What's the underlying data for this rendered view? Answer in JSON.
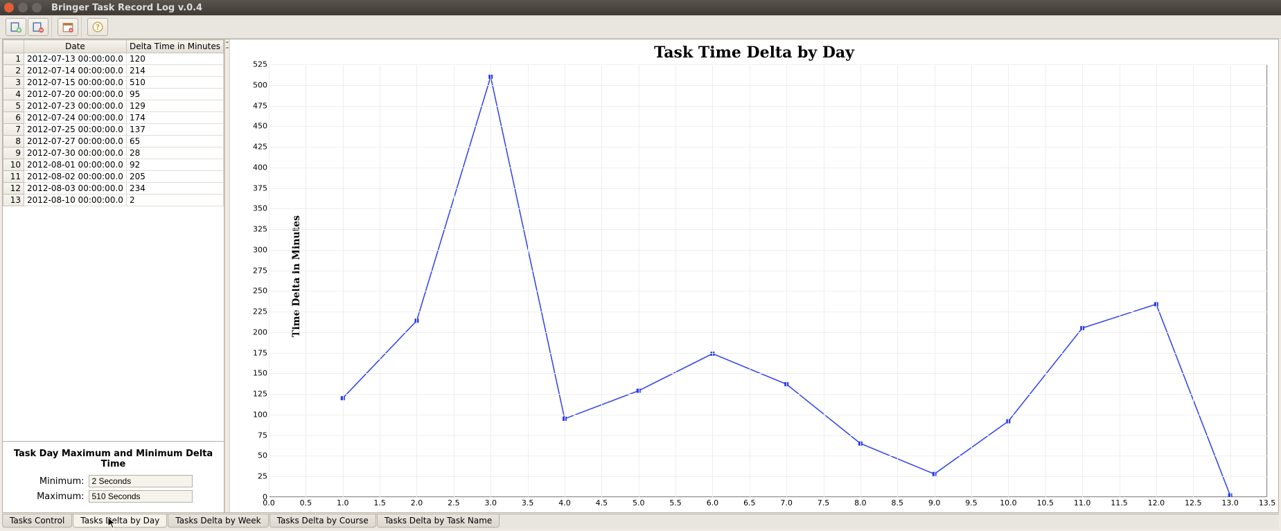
{
  "window": {
    "title": "Bringer Task Record Log v.0.4"
  },
  "toolbar_icons": [
    "new-task-icon",
    "delete-task-icon",
    "calendar-icon",
    "help-icon"
  ],
  "table": {
    "headers": [
      "",
      "Date",
      "Delta Time in Minutes"
    ],
    "rows": [
      {
        "n": "1",
        "date": "2012-07-13 00:00:00.0",
        "delta": "120"
      },
      {
        "n": "2",
        "date": "2012-07-14 00:00:00.0",
        "delta": "214"
      },
      {
        "n": "3",
        "date": "2012-07-15 00:00:00.0",
        "delta": "510"
      },
      {
        "n": "4",
        "date": "2012-07-20 00:00:00.0",
        "delta": "95"
      },
      {
        "n": "5",
        "date": "2012-07-23 00:00:00.0",
        "delta": "129"
      },
      {
        "n": "6",
        "date": "2012-07-24 00:00:00.0",
        "delta": "174"
      },
      {
        "n": "7",
        "date": "2012-07-25 00:00:00.0",
        "delta": "137"
      },
      {
        "n": "8",
        "date": "2012-07-27 00:00:00.0",
        "delta": "65"
      },
      {
        "n": "9",
        "date": "2012-07-30 00:00:00.0",
        "delta": "28"
      },
      {
        "n": "10",
        "date": "2012-08-01 00:00:00.0",
        "delta": "92"
      },
      {
        "n": "11",
        "date": "2012-08-02 00:00:00.0",
        "delta": "205"
      },
      {
        "n": "12",
        "date": "2012-08-03 00:00:00.0",
        "delta": "234"
      },
      {
        "n": "13",
        "date": "2012-08-10 00:00:00.0",
        "delta": "2"
      }
    ]
  },
  "summary": {
    "title": "Task Day Maximum and Minimum Delta Time",
    "min_label": "Minimum:",
    "min_value": "2 Seconds",
    "max_label": "Maximum:",
    "max_value": "510 Seconds"
  },
  "tabs": [
    {
      "label": "Tasks Control",
      "active": false
    },
    {
      "label": "Tasks Delta by Day",
      "active": true
    },
    {
      "label": "Tasks Delta by Week",
      "active": false
    },
    {
      "label": "Tasks Delta by Course",
      "active": false
    },
    {
      "label": "Tasks Delta by Task Name",
      "active": false
    }
  ],
  "chart_data": {
    "type": "line",
    "title": "Task Time Delta by Day",
    "ylabel": "Time Delta in Minutes",
    "xlabel": "",
    "xlim": [
      0,
      13.5
    ],
    "ylim": [
      0,
      525
    ],
    "xticks": [
      0.0,
      0.5,
      1.0,
      1.5,
      2.0,
      2.5,
      3.0,
      3.5,
      4.0,
      4.5,
      5.0,
      5.5,
      6.0,
      6.5,
      7.0,
      7.5,
      8.0,
      8.5,
      9.0,
      9.5,
      10.0,
      10.5,
      11.0,
      11.5,
      12.0,
      12.5,
      13.0,
      13.5
    ],
    "yticks": [
      0,
      25,
      50,
      75,
      100,
      125,
      150,
      175,
      200,
      225,
      250,
      275,
      300,
      325,
      350,
      375,
      400,
      425,
      450,
      475,
      500,
      525
    ],
    "x": [
      1,
      2,
      3,
      4,
      5,
      6,
      7,
      8,
      9,
      10,
      11,
      12,
      13
    ],
    "values": [
      120,
      214,
      510,
      95,
      129,
      174,
      137,
      65,
      28,
      92,
      205,
      234,
      2
    ],
    "color": "#2a3ef0"
  }
}
